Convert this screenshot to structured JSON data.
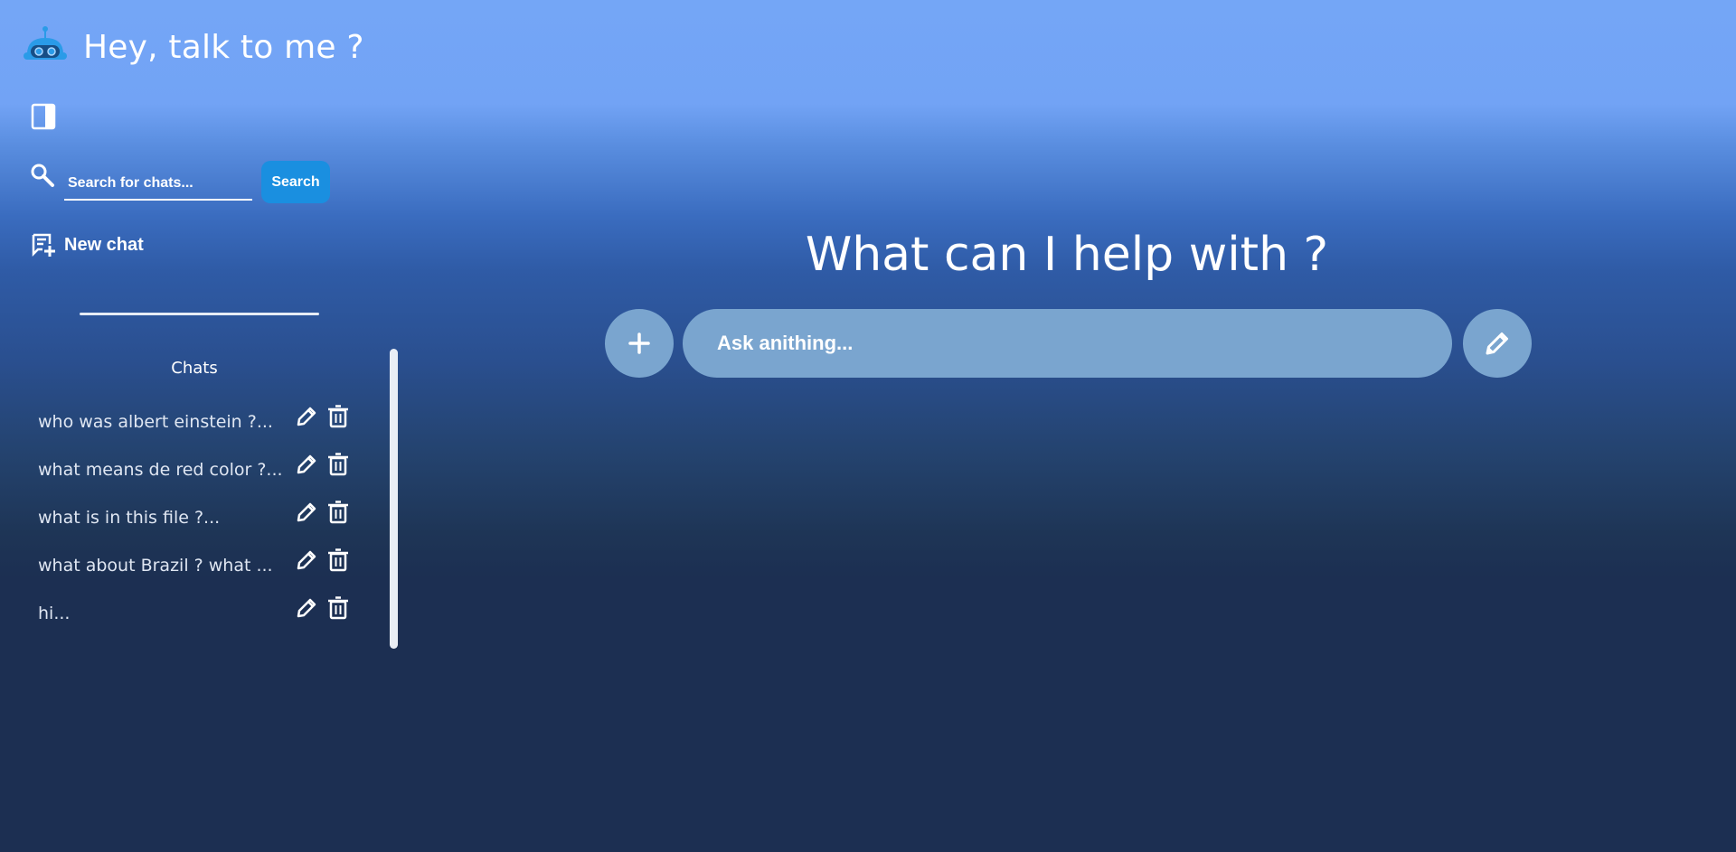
{
  "header": {
    "title": "Hey, talk to me ?",
    "logo": "robot-logo-icon"
  },
  "sidebar": {
    "toggle_icon": "sidebar-toggle-icon",
    "search": {
      "placeholder": "Search for chats...",
      "value": "",
      "button_label": "Search"
    },
    "new_chat_label": "New chat",
    "chats_heading": "Chats",
    "chats": [
      {
        "title": "who was albert einstein ?..."
      },
      {
        "title": "what means de red color ?..."
      },
      {
        "title": "what is in this file ?..."
      },
      {
        "title": "what about Brazil ? what ..."
      },
      {
        "title": "hi..."
      }
    ]
  },
  "main": {
    "heading": "What can I help with ?",
    "ask": {
      "placeholder": "Ask anithing...",
      "value": ""
    },
    "attach_icon": "plus-icon",
    "compose_icon": "pencil-icon"
  },
  "colors": {
    "gradient_top": "#74a6f6",
    "gradient_bottom": "#1c2f52",
    "accent": "#1a8fe0",
    "input_fill": "#7aa5cf"
  }
}
